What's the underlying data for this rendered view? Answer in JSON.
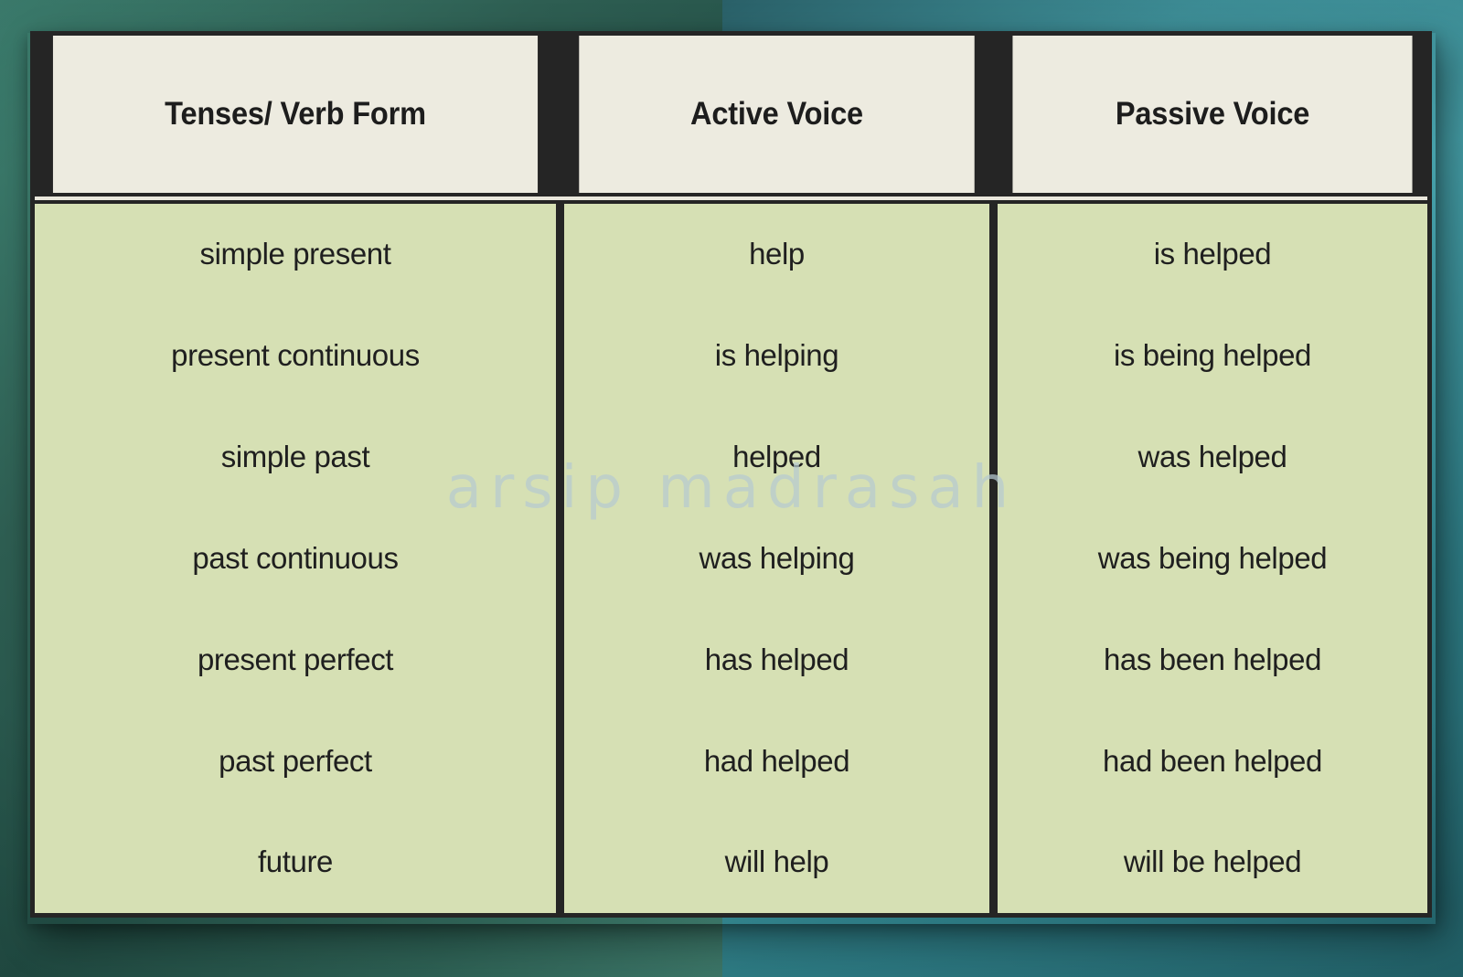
{
  "theme": {
    "background_left": "#2e5e52",
    "background_right": "#3e8f98",
    "table_border": "#252525",
    "header_bg": "#edebe0",
    "body_bg": "#d6e0b4",
    "text_color": "#1f1f1f",
    "watermark_color": "#b7cbd1"
  },
  "watermark": {
    "text": "arsip madrasah"
  },
  "table": {
    "headers": [
      "Tenses/ Verb Form",
      "Active Voice",
      "Passive Voice"
    ],
    "rows": [
      {
        "tense": "simple present",
        "active": "help",
        "passive": "is helped"
      },
      {
        "tense": "present continuous",
        "active": "is helping",
        "passive": "is being helped"
      },
      {
        "tense": "simple past",
        "active": "helped",
        "passive": "was helped"
      },
      {
        "tense": "past continuous",
        "active": "was helping",
        "passive": "was being helped"
      },
      {
        "tense": "present perfect",
        "active": "has helped",
        "passive": "has been helped"
      },
      {
        "tense": "past perfect",
        "active": "had helped",
        "passive": "had been helped"
      },
      {
        "tense": "future",
        "active": "will help",
        "passive": "will be helped"
      }
    ]
  }
}
